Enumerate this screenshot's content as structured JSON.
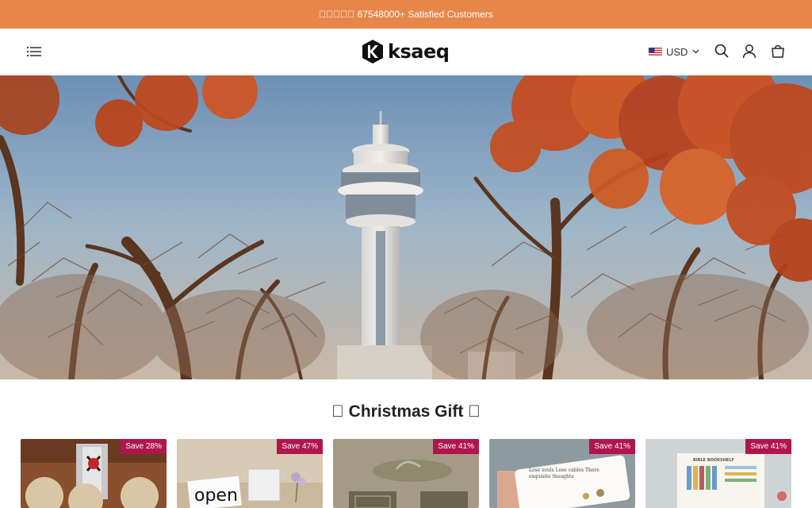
{
  "announcement": {
    "text": "󰀀󰀀󰀀󰀀󰀀 67548000+ Satisfied Customers"
  },
  "header": {
    "brand": "ksaeq",
    "currency": "USD",
    "icons": [
      "menu-icon",
      "search-icon",
      "account-icon",
      "cart-icon"
    ]
  },
  "section": {
    "title": "󰀀 Christmas Gift 󰀀"
  },
  "products": [
    {
      "badge": "Save 28%"
    },
    {
      "badge": "Save 47%"
    },
    {
      "badge": "Save 41%"
    },
    {
      "badge": "Save 41%"
    },
    {
      "badge": "Save 41%"
    }
  ],
  "product_images": [
    {
      "text": ""
    },
    {
      "text": "open"
    },
    {
      "text": ""
    },
    {
      "text": "Lose souls Lose cables There exquisite thoughts"
    },
    {
      "text": "BIBLE BOOKSHELF"
    }
  ],
  "colors": {
    "announcement_bg": "#e8864a",
    "badge_bg": "#b0164d"
  }
}
